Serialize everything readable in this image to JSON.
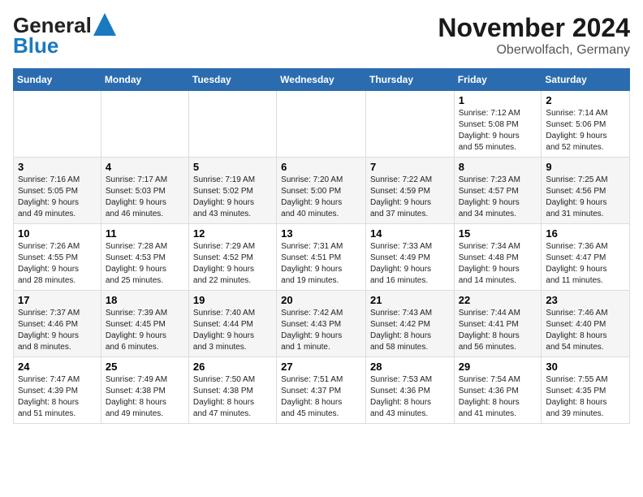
{
  "header": {
    "logo_line1": "General",
    "logo_line2": "Blue",
    "month_title": "November 2024",
    "location": "Oberwolfach, Germany"
  },
  "weekdays": [
    "Sunday",
    "Monday",
    "Tuesday",
    "Wednesday",
    "Thursday",
    "Friday",
    "Saturday"
  ],
  "weeks": [
    [
      {
        "day": "",
        "info": ""
      },
      {
        "day": "",
        "info": ""
      },
      {
        "day": "",
        "info": ""
      },
      {
        "day": "",
        "info": ""
      },
      {
        "day": "",
        "info": ""
      },
      {
        "day": "1",
        "info": "Sunrise: 7:12 AM\nSunset: 5:08 PM\nDaylight: 9 hours\nand 55 minutes."
      },
      {
        "day": "2",
        "info": "Sunrise: 7:14 AM\nSunset: 5:06 PM\nDaylight: 9 hours\nand 52 minutes."
      }
    ],
    [
      {
        "day": "3",
        "info": "Sunrise: 7:16 AM\nSunset: 5:05 PM\nDaylight: 9 hours\nand 49 minutes."
      },
      {
        "day": "4",
        "info": "Sunrise: 7:17 AM\nSunset: 5:03 PM\nDaylight: 9 hours\nand 46 minutes."
      },
      {
        "day": "5",
        "info": "Sunrise: 7:19 AM\nSunset: 5:02 PM\nDaylight: 9 hours\nand 43 minutes."
      },
      {
        "day": "6",
        "info": "Sunrise: 7:20 AM\nSunset: 5:00 PM\nDaylight: 9 hours\nand 40 minutes."
      },
      {
        "day": "7",
        "info": "Sunrise: 7:22 AM\nSunset: 4:59 PM\nDaylight: 9 hours\nand 37 minutes."
      },
      {
        "day": "8",
        "info": "Sunrise: 7:23 AM\nSunset: 4:57 PM\nDaylight: 9 hours\nand 34 minutes."
      },
      {
        "day": "9",
        "info": "Sunrise: 7:25 AM\nSunset: 4:56 PM\nDaylight: 9 hours\nand 31 minutes."
      }
    ],
    [
      {
        "day": "10",
        "info": "Sunrise: 7:26 AM\nSunset: 4:55 PM\nDaylight: 9 hours\nand 28 minutes."
      },
      {
        "day": "11",
        "info": "Sunrise: 7:28 AM\nSunset: 4:53 PM\nDaylight: 9 hours\nand 25 minutes."
      },
      {
        "day": "12",
        "info": "Sunrise: 7:29 AM\nSunset: 4:52 PM\nDaylight: 9 hours\nand 22 minutes."
      },
      {
        "day": "13",
        "info": "Sunrise: 7:31 AM\nSunset: 4:51 PM\nDaylight: 9 hours\nand 19 minutes."
      },
      {
        "day": "14",
        "info": "Sunrise: 7:33 AM\nSunset: 4:49 PM\nDaylight: 9 hours\nand 16 minutes."
      },
      {
        "day": "15",
        "info": "Sunrise: 7:34 AM\nSunset: 4:48 PM\nDaylight: 9 hours\nand 14 minutes."
      },
      {
        "day": "16",
        "info": "Sunrise: 7:36 AM\nSunset: 4:47 PM\nDaylight: 9 hours\nand 11 minutes."
      }
    ],
    [
      {
        "day": "17",
        "info": "Sunrise: 7:37 AM\nSunset: 4:46 PM\nDaylight: 9 hours\nand 8 minutes."
      },
      {
        "day": "18",
        "info": "Sunrise: 7:39 AM\nSunset: 4:45 PM\nDaylight: 9 hours\nand 6 minutes."
      },
      {
        "day": "19",
        "info": "Sunrise: 7:40 AM\nSunset: 4:44 PM\nDaylight: 9 hours\nand 3 minutes."
      },
      {
        "day": "20",
        "info": "Sunrise: 7:42 AM\nSunset: 4:43 PM\nDaylight: 9 hours\nand 1 minute."
      },
      {
        "day": "21",
        "info": "Sunrise: 7:43 AM\nSunset: 4:42 PM\nDaylight: 8 hours\nand 58 minutes."
      },
      {
        "day": "22",
        "info": "Sunrise: 7:44 AM\nSunset: 4:41 PM\nDaylight: 8 hours\nand 56 minutes."
      },
      {
        "day": "23",
        "info": "Sunrise: 7:46 AM\nSunset: 4:40 PM\nDaylight: 8 hours\nand 54 minutes."
      }
    ],
    [
      {
        "day": "24",
        "info": "Sunrise: 7:47 AM\nSunset: 4:39 PM\nDaylight: 8 hours\nand 51 minutes."
      },
      {
        "day": "25",
        "info": "Sunrise: 7:49 AM\nSunset: 4:38 PM\nDaylight: 8 hours\nand 49 minutes."
      },
      {
        "day": "26",
        "info": "Sunrise: 7:50 AM\nSunset: 4:38 PM\nDaylight: 8 hours\nand 47 minutes."
      },
      {
        "day": "27",
        "info": "Sunrise: 7:51 AM\nSunset: 4:37 PM\nDaylight: 8 hours\nand 45 minutes."
      },
      {
        "day": "28",
        "info": "Sunrise: 7:53 AM\nSunset: 4:36 PM\nDaylight: 8 hours\nand 43 minutes."
      },
      {
        "day": "29",
        "info": "Sunrise: 7:54 AM\nSunset: 4:36 PM\nDaylight: 8 hours\nand 41 minutes."
      },
      {
        "day": "30",
        "info": "Sunrise: 7:55 AM\nSunset: 4:35 PM\nDaylight: 8 hours\nand 39 minutes."
      }
    ]
  ]
}
